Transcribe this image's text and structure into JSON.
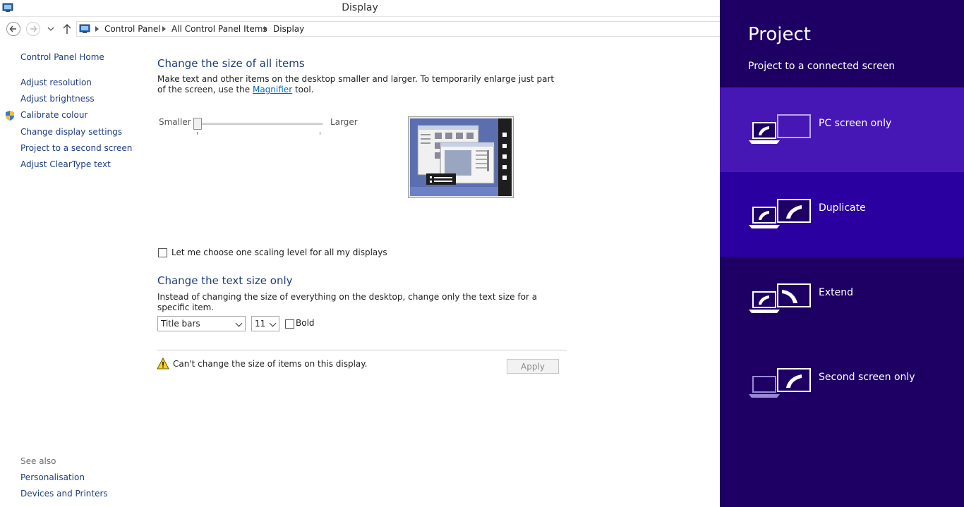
{
  "window": {
    "title": "Display"
  },
  "breadcrumb": [
    "Control Panel",
    "All Control Panel Items",
    "Display"
  ],
  "sidebar": {
    "home": "Control Panel Home",
    "links": [
      "Adjust resolution",
      "Adjust brightness",
      "Calibrate colour",
      "Change display settings",
      "Project to a second screen",
      "Adjust ClearType text"
    ],
    "see_also_label": "See also",
    "see_also": [
      "Personalisation",
      "Devices and Printers"
    ]
  },
  "main": {
    "heading1": "Change the size of all items",
    "desc1_before": "Make text and other items on the desktop smaller and larger. To temporarily enlarge just part of the screen, use the ",
    "desc1_link": "Magnifier",
    "desc1_after": " tool.",
    "slider_min_label": "Smaller",
    "slider_max_label": "Larger",
    "slider_value": 0,
    "checkbox_label": "Let me choose one scaling level for all my displays",
    "heading2": "Change the text size only",
    "desc2": "Instead of changing the size of everything on the desktop, change only the text size for a specific item.",
    "item_select_value": "Title bars",
    "size_select_value": "11",
    "bold_label": "Bold",
    "warning_text": "Can't change the size of items on this display.",
    "apply_label": "Apply"
  },
  "project_pane": {
    "title": "Project",
    "subtitle": "Project to a connected screen",
    "options": [
      {
        "label": "PC screen only",
        "selected": true
      },
      {
        "label": "Duplicate",
        "selected": false
      },
      {
        "label": "Extend",
        "selected": false
      },
      {
        "label": "Second screen only",
        "selected": false
      }
    ],
    "colors": {
      "background": "#1e0064",
      "selected": "#4617b4",
      "hover": "#2a00a0"
    }
  }
}
